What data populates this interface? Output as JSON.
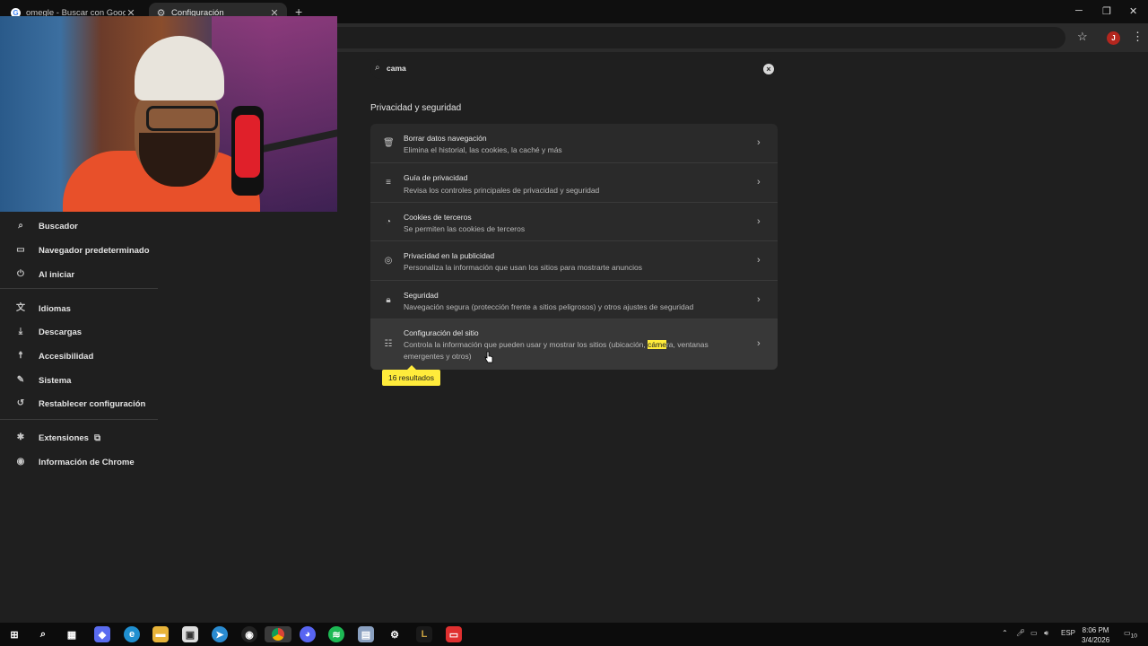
{
  "tabs": [
    {
      "title": "omegle - Buscar con Google"
    },
    {
      "title": "Configuración"
    }
  ],
  "toolbar": {
    "profile_initial": "J"
  },
  "sidebar": {
    "items": [
      {
        "label": "Buscador",
        "icon": "search-icon"
      },
      {
        "label": "Navegador predeterminado",
        "icon": "browser-icon"
      },
      {
        "label": "Al iniciar",
        "icon": "power-icon"
      },
      {
        "label": "Idiomas",
        "icon": "translate-icon"
      },
      {
        "label": "Descargas",
        "icon": "download-icon"
      },
      {
        "label": "Accesibilidad",
        "icon": "accessibility-icon"
      },
      {
        "label": "Sistema",
        "icon": "wrench-icon"
      },
      {
        "label": "Restablecer configuración",
        "icon": "reset-icon"
      },
      {
        "label": "Extensiones",
        "icon": "puzzle-icon"
      },
      {
        "label": "Información de Chrome",
        "icon": "chrome-icon"
      }
    ]
  },
  "search": {
    "value": "cama"
  },
  "section": {
    "title": "Privacidad y seguridad"
  },
  "rows": [
    {
      "title": "Borrar datos navegación",
      "subtitle": "Elimina el historial, las cookies, la caché y más"
    },
    {
      "title": "Guía de privacidad",
      "subtitle": "Revisa los controles principales de privacidad y seguridad"
    },
    {
      "title": "Cookies de terceros",
      "subtitle": "Se permiten las cookies de terceros"
    },
    {
      "title": "Privacidad en la publicidad",
      "subtitle": "Personaliza la información que usan los sitios para mostrarte anuncios"
    },
    {
      "title": "Seguridad",
      "subtitle": "Navegación segura (protección frente a sitios peligrosos) y otros ajustes de seguridad"
    },
    {
      "title": "Configuración del sitio",
      "subtitle_pre": "Controla la información que pueden usar y mostrar los sitios (ubicación, ",
      "subtitle_mark": "cáme",
      "subtitle_post": "ra, ventanas emergentes y otros)"
    }
  ],
  "results_badge": "16 resultados",
  "taskbar": {
    "apps": [
      "windows-icon",
      "search-icon",
      "task-view-icon",
      "copilot-icon",
      "edge-icon",
      "file-explorer-icon",
      "store-icon",
      "telegram-icon",
      "obs-icon",
      "chrome-icon",
      "discord-icon",
      "spotify-icon",
      "app-icon",
      "settings-icon",
      "league-icon",
      "app-red-icon"
    ],
    "lang": "ESP",
    "time": "8:06 PM",
    "date": "3/4/2026",
    "notifications": "10"
  }
}
